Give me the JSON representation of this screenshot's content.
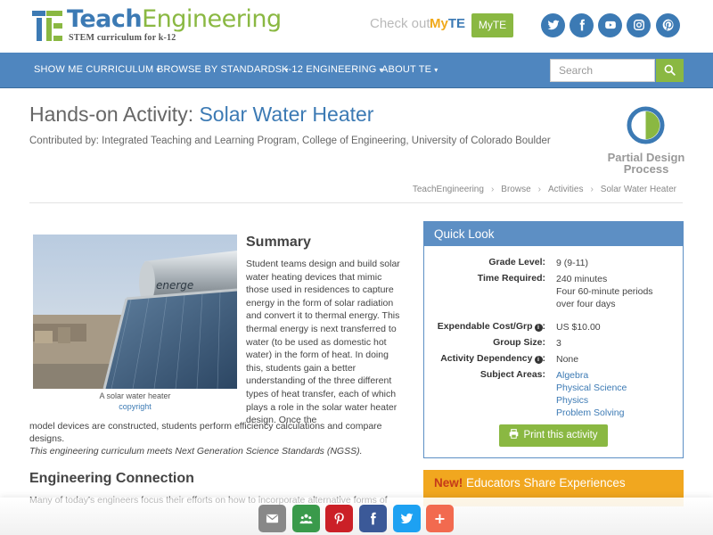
{
  "header": {
    "logo_teach": "Teach",
    "logo_engineering": "Engineering",
    "logo_tagline": "STEM curriculum for k-12",
    "checkout_text": "Check out",
    "myte_my": "My",
    "myte_te": "TE",
    "myte_button": "MyTE",
    "social_icons": [
      "twitter-icon",
      "facebook-icon",
      "youtube-icon",
      "instagram-icon",
      "pinterest-icon"
    ]
  },
  "nav": {
    "items": [
      {
        "label": "SHOW ME CURRICULUM"
      },
      {
        "label": "BROWSE BY STANDARDS"
      },
      {
        "label": "K-12 ENGINEERING"
      },
      {
        "label": "ABOUT TE"
      }
    ],
    "search_placeholder": "Search"
  },
  "page": {
    "title_prefix": "Hands-on Activity: ",
    "title_name": "Solar Water Heater",
    "contributed_by": "Contributed by: Integrated Teaching and Learning Program, College of Engineering, University of Colorado Boulder",
    "design_process_label": "Partial Design Process",
    "breadcrumb": [
      "TeachEngineering",
      "Browse",
      "Activities",
      "Solar Water Heater"
    ]
  },
  "photo": {
    "caption": "A solar water heater",
    "copyright": "copyright",
    "tank_label": "energe"
  },
  "summary": {
    "heading": "Summary",
    "body_top": "Student teams design and build solar water heating devices that mimic those used in residences to capture energy in the form of solar radiation and convert it to thermal energy. This thermal energy is next transferred to water (to be used as domestic hot water) in the form of heat. In doing this, students gain a better understanding of the three different types of heat transfer, each of which plays a role in the solar water heater design. Once the",
    "body_tail": "model devices are constructed, students perform efficiency calculations and compare designs.",
    "ngss_note": "This engineering curriculum meets Next Generation Science Standards (NGSS)."
  },
  "engineering": {
    "heading": "Engineering Connection",
    "body": "Many of today's engineers focus their efforts on how to incorporate alternative forms of"
  },
  "quick_look": {
    "heading": "Quick Look",
    "grade_label": "Grade Level:",
    "grade_value": "9 (9-11)",
    "time_label": "Time Required:",
    "time_value_1": "240 minutes",
    "time_value_2": "Four 60-minute periods over four days",
    "cost_label": "Expendable Cost/Grp",
    "cost_value": "US $10.00",
    "group_label": "Group Size:",
    "group_value": "3",
    "dependency_label": "Activity Dependency",
    "dependency_value": "None",
    "subject_label": "Subject Areas:",
    "subjects": [
      "Algebra",
      "Physical Science",
      "Physics",
      "Problem Solving"
    ],
    "print_button": "Print this activity",
    "info_glyph": "i"
  },
  "educators": {
    "new_label": "New!",
    "text": " Educators Share Experiences"
  },
  "share_bar": {
    "buttons": [
      {
        "name": "email-icon",
        "color": "#888888"
      },
      {
        "name": "classroom-icon",
        "color": "#3a9a4b"
      },
      {
        "name": "pinterest-icon",
        "color": "#cb2027"
      },
      {
        "name": "facebook-icon",
        "color": "#3b5998"
      },
      {
        "name": "twitter-icon",
        "color": "#1da1f2"
      },
      {
        "name": "more-icon",
        "color": "#f26a4f",
        "glyph": "+"
      }
    ]
  },
  "colors": {
    "brand_blue": "#3c7ab4",
    "brand_green": "#8ab842",
    "nav_blue": "#4f86bf",
    "educators_orange": "#f1a71f"
  }
}
